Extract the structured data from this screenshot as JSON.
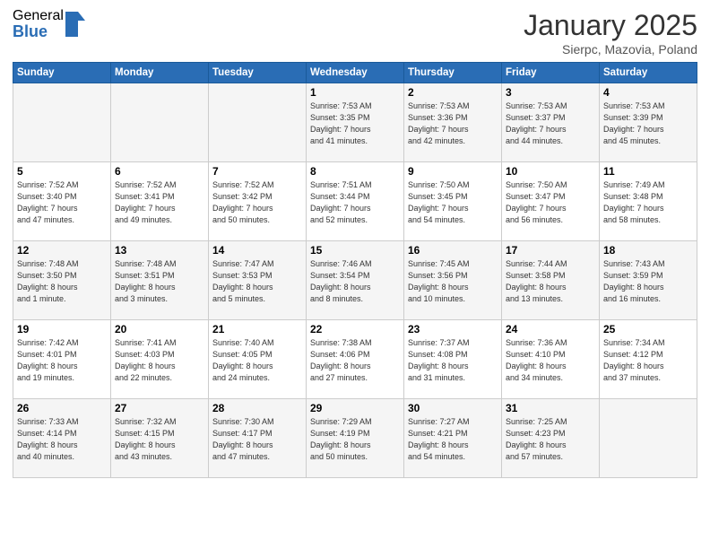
{
  "logo": {
    "general": "General",
    "blue": "Blue"
  },
  "header": {
    "month": "January 2025",
    "location": "Sierpc, Mazovia, Poland"
  },
  "days_of_week": [
    "Sunday",
    "Monday",
    "Tuesday",
    "Wednesday",
    "Thursday",
    "Friday",
    "Saturday"
  ],
  "weeks": [
    [
      {
        "day": "",
        "info": ""
      },
      {
        "day": "",
        "info": ""
      },
      {
        "day": "",
        "info": ""
      },
      {
        "day": "1",
        "info": "Sunrise: 7:53 AM\nSunset: 3:35 PM\nDaylight: 7 hours\nand 41 minutes."
      },
      {
        "day": "2",
        "info": "Sunrise: 7:53 AM\nSunset: 3:36 PM\nDaylight: 7 hours\nand 42 minutes."
      },
      {
        "day": "3",
        "info": "Sunrise: 7:53 AM\nSunset: 3:37 PM\nDaylight: 7 hours\nand 44 minutes."
      },
      {
        "day": "4",
        "info": "Sunrise: 7:53 AM\nSunset: 3:39 PM\nDaylight: 7 hours\nand 45 minutes."
      }
    ],
    [
      {
        "day": "5",
        "info": "Sunrise: 7:52 AM\nSunset: 3:40 PM\nDaylight: 7 hours\nand 47 minutes."
      },
      {
        "day": "6",
        "info": "Sunrise: 7:52 AM\nSunset: 3:41 PM\nDaylight: 7 hours\nand 49 minutes."
      },
      {
        "day": "7",
        "info": "Sunrise: 7:52 AM\nSunset: 3:42 PM\nDaylight: 7 hours\nand 50 minutes."
      },
      {
        "day": "8",
        "info": "Sunrise: 7:51 AM\nSunset: 3:44 PM\nDaylight: 7 hours\nand 52 minutes."
      },
      {
        "day": "9",
        "info": "Sunrise: 7:50 AM\nSunset: 3:45 PM\nDaylight: 7 hours\nand 54 minutes."
      },
      {
        "day": "10",
        "info": "Sunrise: 7:50 AM\nSunset: 3:47 PM\nDaylight: 7 hours\nand 56 minutes."
      },
      {
        "day": "11",
        "info": "Sunrise: 7:49 AM\nSunset: 3:48 PM\nDaylight: 7 hours\nand 58 minutes."
      }
    ],
    [
      {
        "day": "12",
        "info": "Sunrise: 7:48 AM\nSunset: 3:50 PM\nDaylight: 8 hours\nand 1 minute."
      },
      {
        "day": "13",
        "info": "Sunrise: 7:48 AM\nSunset: 3:51 PM\nDaylight: 8 hours\nand 3 minutes."
      },
      {
        "day": "14",
        "info": "Sunrise: 7:47 AM\nSunset: 3:53 PM\nDaylight: 8 hours\nand 5 minutes."
      },
      {
        "day": "15",
        "info": "Sunrise: 7:46 AM\nSunset: 3:54 PM\nDaylight: 8 hours\nand 8 minutes."
      },
      {
        "day": "16",
        "info": "Sunrise: 7:45 AM\nSunset: 3:56 PM\nDaylight: 8 hours\nand 10 minutes."
      },
      {
        "day": "17",
        "info": "Sunrise: 7:44 AM\nSunset: 3:58 PM\nDaylight: 8 hours\nand 13 minutes."
      },
      {
        "day": "18",
        "info": "Sunrise: 7:43 AM\nSunset: 3:59 PM\nDaylight: 8 hours\nand 16 minutes."
      }
    ],
    [
      {
        "day": "19",
        "info": "Sunrise: 7:42 AM\nSunset: 4:01 PM\nDaylight: 8 hours\nand 19 minutes."
      },
      {
        "day": "20",
        "info": "Sunrise: 7:41 AM\nSunset: 4:03 PM\nDaylight: 8 hours\nand 22 minutes."
      },
      {
        "day": "21",
        "info": "Sunrise: 7:40 AM\nSunset: 4:05 PM\nDaylight: 8 hours\nand 24 minutes."
      },
      {
        "day": "22",
        "info": "Sunrise: 7:38 AM\nSunset: 4:06 PM\nDaylight: 8 hours\nand 27 minutes."
      },
      {
        "day": "23",
        "info": "Sunrise: 7:37 AM\nSunset: 4:08 PM\nDaylight: 8 hours\nand 31 minutes."
      },
      {
        "day": "24",
        "info": "Sunrise: 7:36 AM\nSunset: 4:10 PM\nDaylight: 8 hours\nand 34 minutes."
      },
      {
        "day": "25",
        "info": "Sunrise: 7:34 AM\nSunset: 4:12 PM\nDaylight: 8 hours\nand 37 minutes."
      }
    ],
    [
      {
        "day": "26",
        "info": "Sunrise: 7:33 AM\nSunset: 4:14 PM\nDaylight: 8 hours\nand 40 minutes."
      },
      {
        "day": "27",
        "info": "Sunrise: 7:32 AM\nSunset: 4:15 PM\nDaylight: 8 hours\nand 43 minutes."
      },
      {
        "day": "28",
        "info": "Sunrise: 7:30 AM\nSunset: 4:17 PM\nDaylight: 8 hours\nand 47 minutes."
      },
      {
        "day": "29",
        "info": "Sunrise: 7:29 AM\nSunset: 4:19 PM\nDaylight: 8 hours\nand 50 minutes."
      },
      {
        "day": "30",
        "info": "Sunrise: 7:27 AM\nSunset: 4:21 PM\nDaylight: 8 hours\nand 54 minutes."
      },
      {
        "day": "31",
        "info": "Sunrise: 7:25 AM\nSunset: 4:23 PM\nDaylight: 8 hours\nand 57 minutes."
      },
      {
        "day": "",
        "info": ""
      }
    ]
  ]
}
